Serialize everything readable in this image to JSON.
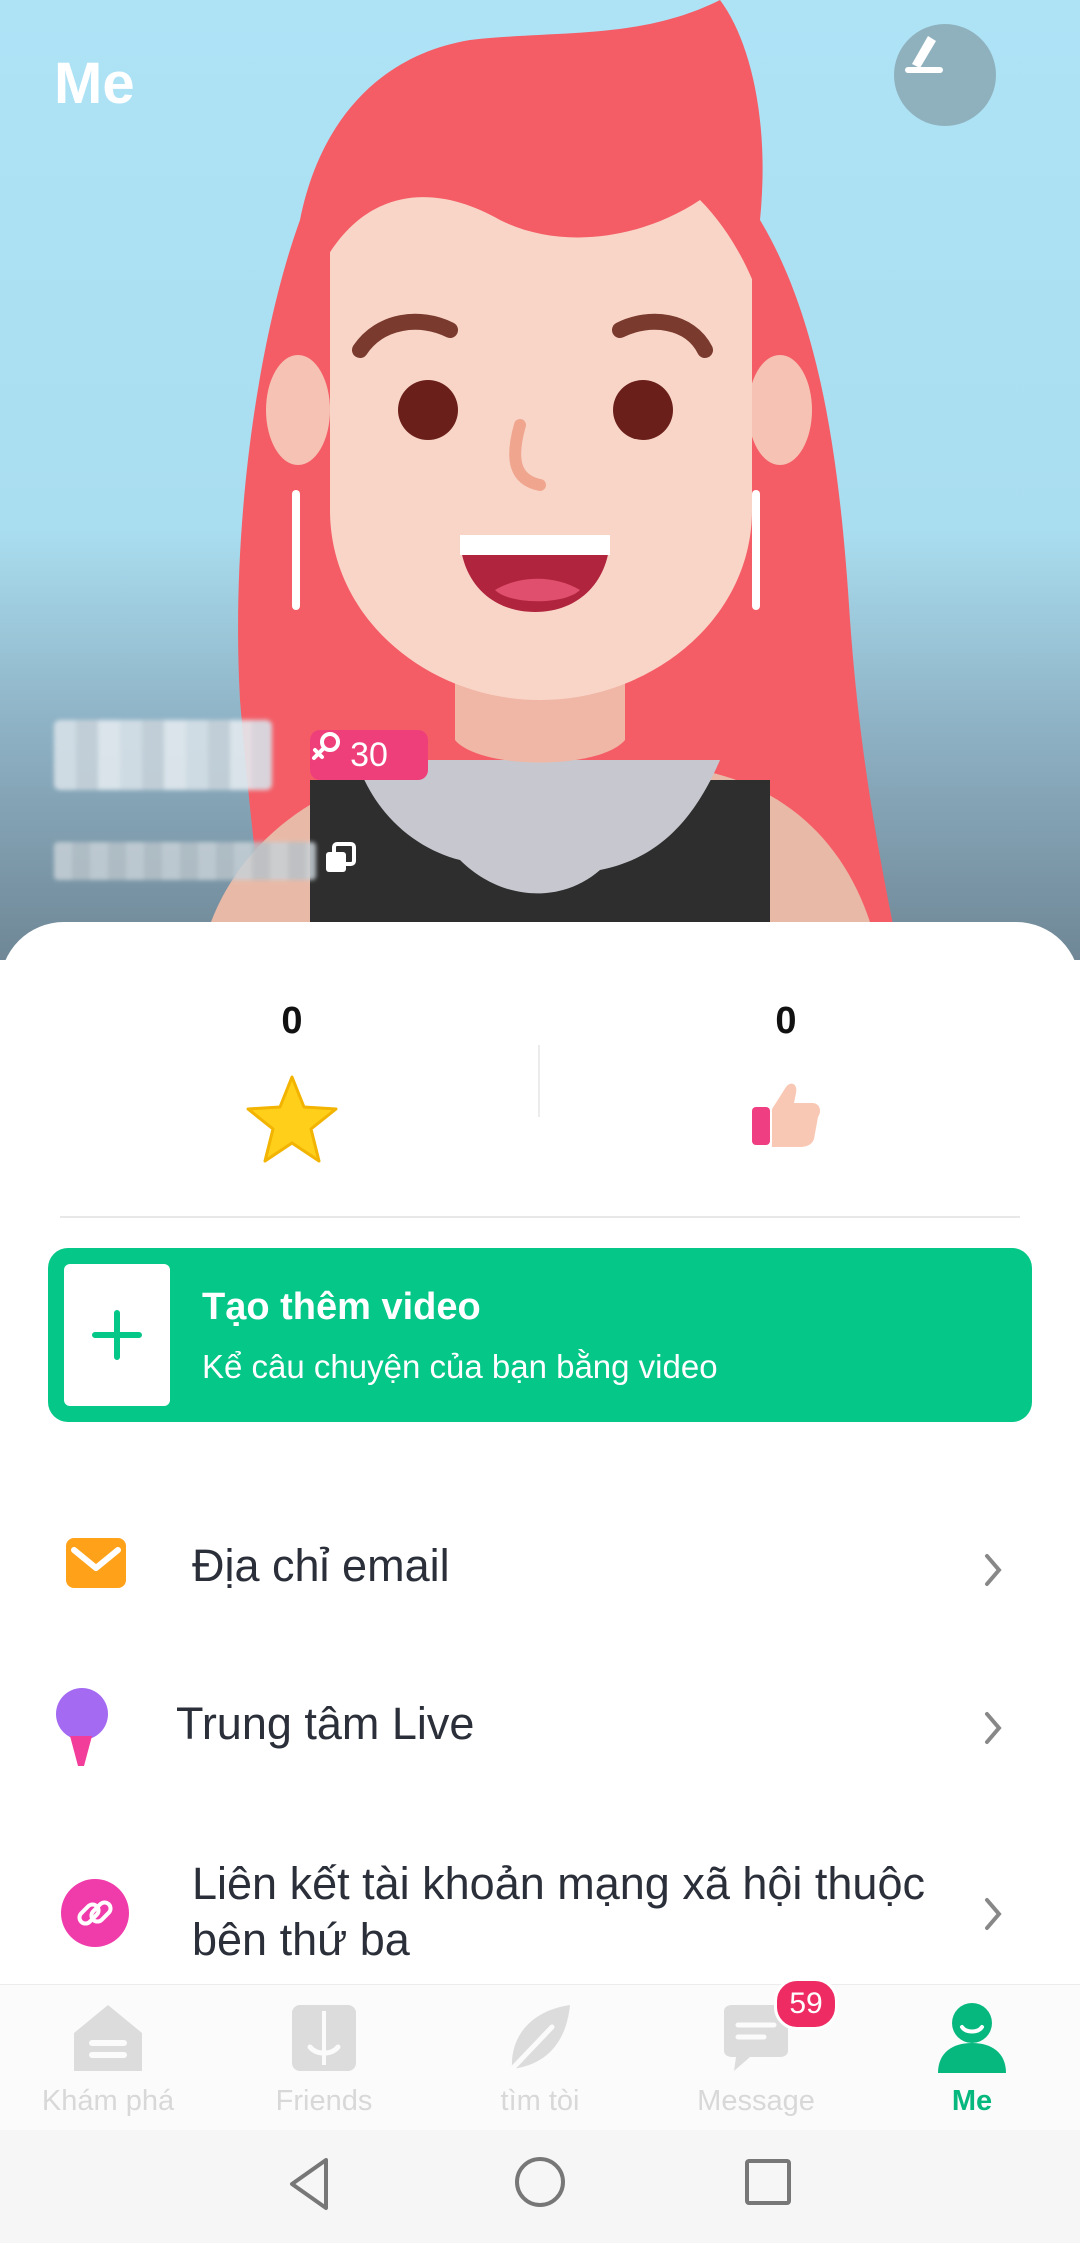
{
  "header": {
    "title": "Me"
  },
  "profile": {
    "level": "30"
  },
  "stats": [
    {
      "value": "0",
      "icon": "star-icon"
    },
    {
      "value": "0",
      "icon": "thumbs-up-icon"
    }
  ],
  "create_video": {
    "title": "Tạo thêm video",
    "subtitle": "Kể câu chuyện của bạn bằng video"
  },
  "menu": [
    {
      "label": "Địa chỉ email",
      "icon": "email-icon"
    },
    {
      "label": "Trung tâm Live",
      "icon": "microphone-icon"
    },
    {
      "label_line1": "Liên kết tài khoản mạng xã hội thuộc",
      "label_line2": "bên thứ ba",
      "icon": "link-icon"
    }
  ],
  "bottom_nav": [
    {
      "label": "Khám phá",
      "icon": "home-icon"
    },
    {
      "label": "Friends",
      "icon": "friends-icon"
    },
    {
      "label": "tìm tòi",
      "icon": "feather-icon"
    },
    {
      "label": "Message",
      "icon": "message-icon",
      "badge": "59"
    },
    {
      "label": "Me",
      "icon": "profile-icon",
      "active": true
    }
  ],
  "colors": {
    "accent": "#04c788",
    "badge": "#ef3f7a",
    "nav_active": "#07b87e"
  }
}
